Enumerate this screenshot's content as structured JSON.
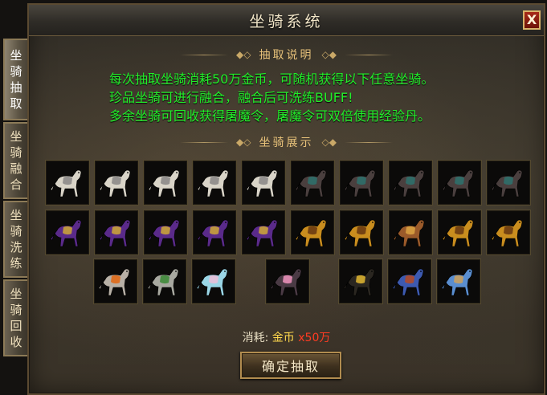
{
  "window": {
    "title": "坐骑系统",
    "close_label": "X"
  },
  "side_tabs": [
    {
      "label": "坐骑抽取",
      "active": true
    },
    {
      "label": "坐骑融合",
      "active": false
    },
    {
      "label": "坐骑洗练",
      "active": false
    },
    {
      "label": "坐骑回收",
      "active": false
    }
  ],
  "sections": {
    "description_title": "抽取说明",
    "showcase_title": "坐骑展示"
  },
  "description_lines": [
    "每次抽取坐骑消耗50万金币，可随机获得以下任意坐骑。",
    "珍品坐骑可进行融合，融合后可洗练BUFF!",
    "多余坐骑可回收获得屠魔令，屠魔令可双倍使用经验丹。"
  ],
  "mount_rows": [
    [
      {
        "name": "white-horse-icon",
        "body": "#d9d4c8",
        "saddle": "#8c8a88"
      },
      {
        "name": "white-horse-icon",
        "body": "#d9d4c8",
        "saddle": "#8c8a88"
      },
      {
        "name": "white-horse-icon",
        "body": "#d9d4c8",
        "saddle": "#8c8a88"
      },
      {
        "name": "white-horse-icon",
        "body": "#d9d4c8",
        "saddle": "#8c8a88"
      },
      {
        "name": "white-horse-icon",
        "body": "#d9d4c8",
        "saddle": "#8c8a88"
      },
      {
        "name": "dark-horse-icon",
        "body": "#4a3f3e",
        "saddle": "#2f6f6a"
      },
      {
        "name": "dark-horse-icon",
        "body": "#4a3f3e",
        "saddle": "#2f6f6a"
      },
      {
        "name": "dark-horse-icon",
        "body": "#4a3f3e",
        "saddle": "#2f6f6a"
      },
      {
        "name": "dark-horse-icon",
        "body": "#4a3f3e",
        "saddle": "#2f6f6a"
      },
      {
        "name": "dark-horse-icon",
        "body": "#4a3f3e",
        "saddle": "#2f6f6a"
      }
    ],
    [
      {
        "name": "purple-horse-icon",
        "body": "#5a2a8a",
        "saddle": "#c9a23a"
      },
      {
        "name": "purple-horse-icon",
        "body": "#5a2a8a",
        "saddle": "#c9a23a"
      },
      {
        "name": "purple-horse-icon",
        "body": "#5a2a8a",
        "saddle": "#c9a23a"
      },
      {
        "name": "purple-horse-icon",
        "body": "#5a2a8a",
        "saddle": "#c9a23a"
      },
      {
        "name": "purple-horse-icon",
        "body": "#5a2a8a",
        "saddle": "#c9a23a"
      },
      {
        "name": "gold-horse-icon",
        "body": "#c98d1e",
        "saddle": "#6b3b12"
      },
      {
        "name": "gold-horse-icon",
        "body": "#c98d1e",
        "saddle": "#6b3b12"
      },
      {
        "name": "brown-horse-icon",
        "body": "#9a5a2a",
        "saddle": "#d8a040"
      },
      {
        "name": "gold-horse-icon",
        "body": "#c98d1e",
        "saddle": "#6b3b12"
      },
      {
        "name": "gold-horse-icon",
        "body": "#c98d1e",
        "saddle": "#6b3b12"
      }
    ],
    [
      {
        "name": "orange-armored-horse-icon",
        "body": "#b8b0a6",
        "saddle": "#e06a18"
      },
      {
        "name": "green-armored-horse-icon",
        "body": "#a8a8a0",
        "saddle": "#3f8a3a"
      },
      {
        "name": "crystal-horse-icon",
        "body": "#9ad6e6",
        "saddle": "#e8c0d8"
      },
      {
        "name": "pink-armored-horse-icon",
        "body": "#4a3a44",
        "saddle": "#e890b8"
      },
      {
        "name": "black-gold-horse-icon",
        "body": "#2a2620",
        "saddle": "#d8b030"
      },
      {
        "name": "blue-horse-icon",
        "body": "#3d5ab0",
        "saddle": "#b04a2a"
      },
      {
        "name": "skyblue-horse-icon",
        "body": "#5a8ed0",
        "saddle": "#c8a060"
      }
    ]
  ],
  "cost": {
    "label": "消耗:",
    "currency": "金币",
    "amount": "x50万"
  },
  "buttons": {
    "draw": "确定抽取"
  }
}
